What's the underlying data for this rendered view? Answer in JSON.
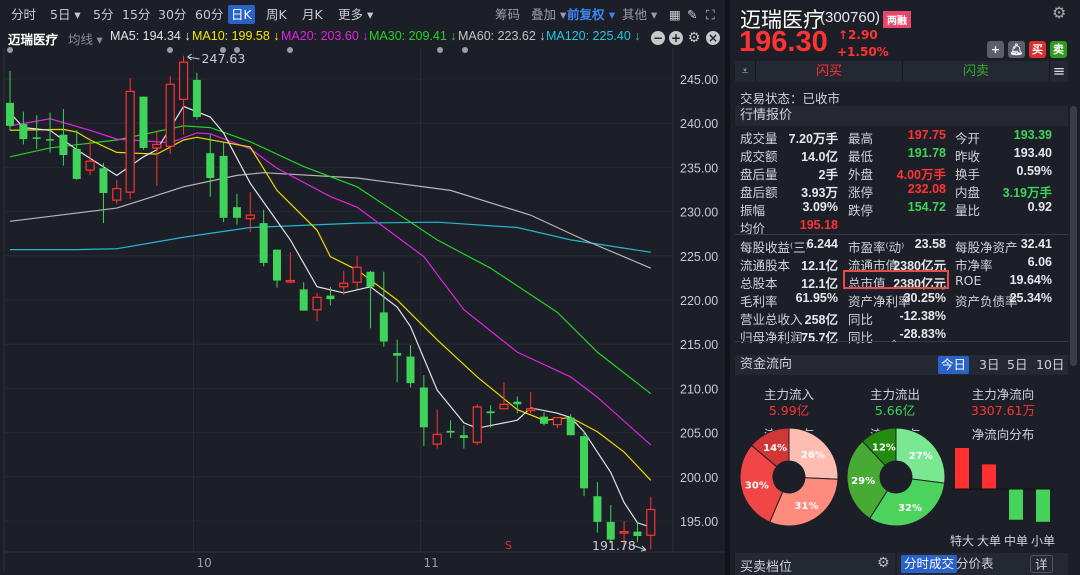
{
  "toolbar": {
    "tabs": [
      "分时",
      "5日 ▾",
      "5分",
      "15分",
      "30分",
      "60分",
      "日K",
      "周K",
      "月K",
      "更多 ▾"
    ],
    "active": "日K",
    "right": [
      "筹码",
      "叠加 ▾",
      "前复权 ▾",
      "其他 ▾"
    ]
  },
  "ma_bar": {
    "stock": "迈瑞医疗",
    "indicator": "均线 ▾",
    "items": [
      {
        "label": "MA5: 194.34 ↓",
        "color": "#e4e4e4"
      },
      {
        "label": "MA10: 199.58 ↓",
        "color": "#f2e600"
      },
      {
        "label": "MA20: 203.60 ↓",
        "color": "#e024e0"
      },
      {
        "label": "MA30: 209.41 ↓",
        "color": "#22d422"
      },
      {
        "label": "MA60: 223.62 ↓",
        "color": "#c4c4c4"
      },
      {
        "label": "MA120: 225.40 ↓",
        "color": "#22c8e0"
      }
    ]
  },
  "chart_data": {
    "type": "candlestick",
    "ylim": [
      191,
      248.5
    ],
    "yticks": [
      "245.00",
      "240.00",
      "235.00",
      "230.00",
      "225.00",
      "220.00",
      "215.00",
      "210.00",
      "205.00",
      "200.00",
      "195.00"
    ],
    "ytick_values": [
      245,
      240,
      235,
      230,
      225,
      220,
      215,
      210,
      205,
      200,
      195
    ],
    "xticks": [
      {
        "label": "10",
        "index": 13
      },
      {
        "label": "11",
        "index": 30
      }
    ],
    "max_label": "247.63",
    "min_label": "191.78",
    "signal": {
      "label": "S",
      "index": 37
    },
    "colors": {
      "up": "#ff3333",
      "down": "#3fd35a"
    },
    "ohlc": [
      [
        242.3,
        245.9,
        239.2,
        239.7
      ],
      [
        239.9,
        241.3,
        237.6,
        238.2
      ],
      [
        238.4,
        240.9,
        237.1,
        238.3
      ],
      [
        238.2,
        241.2,
        236.7,
        238.1
      ],
      [
        238.7,
        241.6,
        235.2,
        236.4
      ],
      [
        237.1,
        239.2,
        233.6,
        233.7
      ],
      [
        234.7,
        238.3,
        234.1,
        235.7
      ],
      [
        234.9,
        235.5,
        228.7,
        232.1
      ],
      [
        231.3,
        233.6,
        230.9,
        232.6
      ],
      [
        232.2,
        245.1,
        231.4,
        243.6
      ],
      [
        243.0,
        243.0,
        237.0,
        237.2
      ],
      [
        237.2,
        239.2,
        232.9,
        237.6
      ],
      [
        237.4,
        245.3,
        236.5,
        244.4
      ],
      [
        242.7,
        247.63,
        238.7,
        246.9
      ],
      [
        244.9,
        245.7,
        240.4,
        240.7
      ],
      [
        236.6,
        238.7,
        231.7,
        233.8
      ],
      [
        236.3,
        237.8,
        228.8,
        229.3
      ],
      [
        230.5,
        232.0,
        228.5,
        229.3
      ],
      [
        229.2,
        232.2,
        227.7,
        229.6
      ],
      [
        228.7,
        230.2,
        223.8,
        224.2
      ],
      [
        225.7,
        225.7,
        221.4,
        222.2
      ],
      [
        222.1,
        225.4,
        221.9,
        222.2
      ],
      [
        221.2,
        222.0,
        218.8,
        218.8
      ],
      [
        218.9,
        220.8,
        217.6,
        220.3
      ],
      [
        220.5,
        221.5,
        219.4,
        220.1
      ],
      [
        221.5,
        223.3,
        220.6,
        221.9
      ],
      [
        222.0,
        225.0,
        221.2,
        223.7
      ],
      [
        223.2,
        223.3,
        216.8,
        221.5
      ],
      [
        218.6,
        223.2,
        214.7,
        215.3
      ],
      [
        214.0,
        215.5,
        210.7,
        213.7
      ],
      [
        213.6,
        214.9,
        210.1,
        210.6
      ],
      [
        210.1,
        211.5,
        203.5,
        205.6
      ],
      [
        203.7,
        207.6,
        203.2,
        204.8
      ],
      [
        205.2,
        206.4,
        204.4,
        205.0
      ],
      [
        204.7,
        205.8,
        203.2,
        204.4
      ],
      [
        203.9,
        208.2,
        203.6,
        207.9
      ],
      [
        207.4,
        208.1,
        205.6,
        207.2
      ],
      [
        207.7,
        210.7,
        207.7,
        208.2
      ],
      [
        208.5,
        209.1,
        207.2,
        208.2
      ],
      [
        207.5,
        209.6,
        207.2,
        207.7
      ],
      [
        206.8,
        207.3,
        205.8,
        206.0
      ],
      [
        205.9,
        206.7,
        205.5,
        206.7
      ],
      [
        206.7,
        207.1,
        204.7,
        204.7
      ],
      [
        204.6,
        205.1,
        197.8,
        198.7
      ],
      [
        197.8,
        199.4,
        193.7,
        194.9
      ],
      [
        194.9,
        196.8,
        192.5,
        192.9
      ],
      [
        193.7,
        195.0,
        191.7,
        193.8
      ],
      [
        193.8,
        194.8,
        192.6,
        193.3
      ],
      [
        193.39,
        197.75,
        191.78,
        196.3
      ]
    ],
    "ma": [
      {
        "name": "MA120",
        "color": "#22b8d0",
        "points": [
          [
            0,
            225.7
          ],
          [
            5,
            225.7
          ],
          [
            8,
            225.8
          ],
          [
            13,
            227.1
          ],
          [
            18,
            228.2
          ],
          [
            26,
            228.7
          ],
          [
            32,
            228.8
          ],
          [
            38,
            228.2
          ],
          [
            42,
            226.8
          ],
          [
            48,
            225.4
          ]
        ]
      },
      {
        "name": "MA60",
        "color": "#b8b8b8",
        "points": [
          [
            0,
            228.9
          ],
          [
            8,
            230.4
          ],
          [
            13,
            232.8
          ],
          [
            17,
            234.1
          ],
          [
            19,
            234.4
          ],
          [
            26,
            233.8
          ],
          [
            33,
            232.4
          ],
          [
            39,
            229.6
          ],
          [
            43,
            226.8
          ],
          [
            48,
            223.6
          ]
        ]
      },
      {
        "name": "MA30",
        "color": "#22d422",
        "points": [
          [
            0,
            236.2
          ],
          [
            3,
            237.2
          ],
          [
            8,
            238.1
          ],
          [
            13,
            239.7
          ],
          [
            15,
            239.5
          ],
          [
            18,
            237.9
          ],
          [
            22,
            235.1
          ],
          [
            26,
            232.8
          ],
          [
            32,
            226.8
          ],
          [
            36,
            223.6
          ],
          [
            41,
            218.6
          ],
          [
            44,
            214.1
          ],
          [
            48,
            209.4
          ]
        ]
      },
      {
        "name": "MA20",
        "color": "#e024e0",
        "points": [
          [
            0,
            239.7
          ],
          [
            3,
            240.5
          ],
          [
            6,
            239.2
          ],
          [
            8,
            238.2
          ],
          [
            10,
            238.0
          ],
          [
            12,
            237.8
          ],
          [
            14,
            238.9
          ],
          [
            15,
            238.8
          ],
          [
            18,
            237.1
          ],
          [
            20,
            234.9
          ],
          [
            24,
            231.7
          ],
          [
            26,
            230.5
          ],
          [
            31,
            224.9
          ],
          [
            34,
            218.9
          ],
          [
            38,
            214.1
          ],
          [
            42,
            211.3
          ],
          [
            44,
            209.0
          ],
          [
            48,
            203.6
          ]
        ]
      },
      {
        "name": "MA10",
        "color": "#e8dc00",
        "points": [
          [
            0,
            239.2
          ],
          [
            4,
            239.3
          ],
          [
            5,
            239.0
          ],
          [
            6,
            238.1
          ],
          [
            8,
            236.7
          ],
          [
            11,
            236.5
          ],
          [
            13,
            238.1
          ],
          [
            14,
            238.4
          ],
          [
            18,
            237.3
          ],
          [
            20,
            232.4
          ],
          [
            23,
            227.9
          ],
          [
            24,
            224.9
          ],
          [
            26,
            223.4
          ],
          [
            29,
            220.0
          ],
          [
            32,
            215.5
          ],
          [
            35,
            211.3
          ],
          [
            38,
            207.6
          ],
          [
            40,
            206.4
          ],
          [
            42,
            206.7
          ],
          [
            44,
            205.1
          ],
          [
            46,
            202.8
          ],
          [
            48,
            199.6
          ]
        ]
      },
      {
        "name": "MA5",
        "color": "#e4e4e4",
        "points": [
          [
            0,
            241.2
          ],
          [
            1,
            239.5
          ],
          [
            3,
            239.2
          ],
          [
            5,
            237.0
          ],
          [
            8,
            234.1
          ],
          [
            10,
            236.2
          ],
          [
            11,
            237.0
          ],
          [
            13,
            241.9
          ],
          [
            15,
            240.7
          ],
          [
            16,
            238.9
          ],
          [
            18,
            233.2
          ],
          [
            21,
            226.8
          ],
          [
            23,
            221.5
          ],
          [
            25,
            220.8
          ],
          [
            27,
            221.5
          ],
          [
            29,
            219.2
          ],
          [
            30,
            217.0
          ],
          [
            32,
            209.8
          ],
          [
            34,
            206.1
          ],
          [
            35,
            205.5
          ],
          [
            38,
            206.4
          ],
          [
            39,
            207.8
          ],
          [
            41,
            207.2
          ],
          [
            42,
            206.7
          ],
          [
            43,
            205.1
          ],
          [
            45,
            200.5
          ],
          [
            46,
            197.1
          ],
          [
            47,
            194.8
          ],
          [
            48,
            194.3
          ]
        ]
      }
    ]
  },
  "quote": {
    "name": "迈瑞医疗",
    "code": "(300760)",
    "badge": "两融",
    "price": "196.30",
    "change": "↑2.90",
    "pct": "+1.50%",
    "buy": "买",
    "sell": "卖",
    "flash_buy": "闪买",
    "flash_sell": "闪卖",
    "status": "交易状态：已收市"
  },
  "market": {
    "title": "行情报价",
    "rows": [
      [
        [
          "成交量",
          "7.20万手",
          "w"
        ],
        [
          "最高",
          "197.75",
          "r"
        ],
        [
          "今开",
          "193.39",
          "g"
        ]
      ],
      [
        [
          "成交额",
          "14.0亿",
          "w"
        ],
        [
          "最低",
          "191.78",
          "g"
        ],
        [
          "昨收",
          "193.40",
          "w"
        ]
      ],
      [
        [
          "盘后量",
          "2手",
          "w"
        ],
        [
          "外盘",
          "4.00万手",
          "r"
        ],
        [
          "换手",
          "0.59%",
          "w"
        ]
      ],
      [
        [
          "盘后额",
          "3.93万",
          "w"
        ],
        [
          "涨停",
          "232.08",
          "r"
        ],
        [
          "内盘",
          "3.19万手",
          "g"
        ]
      ],
      [
        [
          "振幅",
          "3.09%",
          "w"
        ],
        [
          "跌停",
          "154.72",
          "g"
        ],
        [
          "量比",
          "0.92",
          "w"
        ]
      ],
      [
        [
          "均价",
          "195.18",
          "r"
        ]
      ]
    ],
    "rows2": [
      [
        [
          "每股收益⁽三⁾",
          "6.244",
          "w"
        ],
        [
          "市盈率⁽动⁾",
          "23.58",
          "w"
        ],
        [
          "每股净资产",
          "32.41",
          "w"
        ]
      ],
      [
        [
          "流通股本",
          "12.1亿",
          "w"
        ],
        [
          "流通市值",
          "2380亿元",
          "w"
        ],
        [
          "市净率",
          "6.06",
          "w"
        ]
      ],
      [
        [
          "总股本",
          "12.1亿",
          "w"
        ],
        [
          "总市值",
          "2380亿元",
          "w"
        ],
        [
          "ROE",
          "19.64%",
          "w"
        ]
      ],
      [
        [
          "毛利率",
          "61.95%",
          "w"
        ],
        [
          "资产净利率",
          "30.25%",
          "w"
        ],
        [
          "资产负债率",
          "25.34%",
          "w"
        ]
      ],
      [
        [
          "营业总收入",
          "258亿",
          "w"
        ],
        [
          "同比",
          "-12.38%",
          "w"
        ]
      ],
      [
        [
          "归母净利润",
          "75.7亿",
          "w"
        ],
        [
          "同比",
          "-28.83%",
          "w"
        ]
      ]
    ]
  },
  "flow": {
    "title": "资金流向",
    "tabs": [
      "今日",
      "3日",
      "5日",
      "10日"
    ],
    "summary": [
      {
        "label": "主力流入",
        "value": "5.99亿",
        "cls": "r"
      },
      {
        "label": "主力流出",
        "value": "5.66亿",
        "cls": "g"
      },
      {
        "label": "主力净流向",
        "value": "3307.61万",
        "cls": "r"
      }
    ],
    "in_title": "流入分布",
    "out_title": "流出分布",
    "net_title": "净流向分布",
    "in_pie": [
      {
        "label": "26%",
        "value": 26,
        "color": "#ffbdb1"
      },
      {
        "label": "31%",
        "value": 31,
        "color": "#ff8b7d"
      },
      {
        "label": "30%",
        "value": 30,
        "color": "#f04646"
      },
      {
        "label": "14%",
        "value": 14,
        "color": "#d23636"
      }
    ],
    "out_pie": [
      {
        "label": "27%",
        "value": 27,
        "color": "#7ae893"
      },
      {
        "label": "32%",
        "value": 32,
        "color": "#4cd35e"
      },
      {
        "label": "29%",
        "value": 29,
        "color": "#47aa35"
      },
      {
        "label": "12%",
        "value": 12,
        "color": "#238c10"
      }
    ],
    "net": [
      {
        "label": "特大",
        "value": 1.0
      },
      {
        "label": "大单",
        "value": 0.6
      },
      {
        "label": "中单",
        "value": -0.75
      },
      {
        "label": "小单",
        "value": -0.8
      }
    ]
  },
  "bottom": {
    "left_title": "买卖档位",
    "tabs": [
      "分时成交",
      "分价表"
    ],
    "detail": "详"
  }
}
